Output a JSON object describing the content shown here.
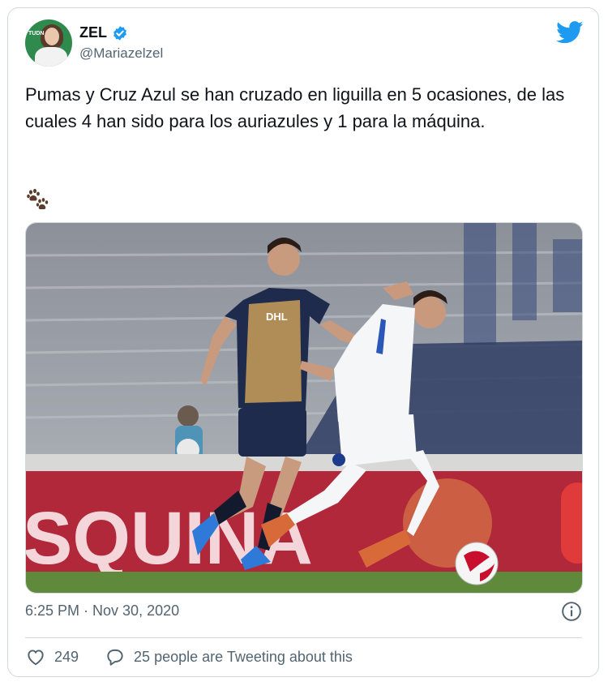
{
  "tweet": {
    "author_name": "ZEL",
    "author_handle": "@Mariazelzel",
    "avatar_tag": "TUDN",
    "text": "Pumas y Cruz Azul se han cruzado en liguilla en 5 ocasiones, de las cuales 4 han sido para los auriazules y 1 para la máquina.",
    "emoji": "paw-prints",
    "timestamp": "6:25 PM · Nov 30, 2020",
    "likes": "249",
    "retweet_text": "25 people are Tweeting about this"
  },
  "photo": {
    "banner_text": "SQUINA",
    "sponsor_text": "DHL"
  },
  "colors": {
    "twitter_blue": "#1d9bf0",
    "secondary_text": "#536471",
    "border": "#cfd9de",
    "pumas_navy": "#1f2b4d",
    "pumas_gold": "#b08c57",
    "banner_red": "#b0283a",
    "pitch_green": "#5f8a3c"
  }
}
